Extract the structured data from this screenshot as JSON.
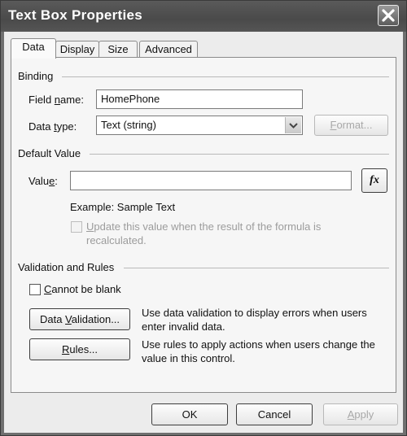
{
  "window": {
    "title": "Text Box Properties"
  },
  "tabs": [
    {
      "label": "Data",
      "active": true
    },
    {
      "label": "Display",
      "active": false
    },
    {
      "label": "Size",
      "active": false
    },
    {
      "label": "Advanced",
      "active": false
    }
  ],
  "binding": {
    "group_label": "Binding",
    "field_name_label_pre": "Field ",
    "field_name_label_u": "n",
    "field_name_label_post": "ame:",
    "field_name_value": "HomePhone",
    "data_type_label_pre": "Data ",
    "data_type_label_u": "t",
    "data_type_label_post": "ype:",
    "data_type_value": "Text (string)",
    "format_button_u": "F",
    "format_button_post": "ormat..."
  },
  "default_value": {
    "group_label": "Default Value",
    "value_label_pre": "Valu",
    "value_label_u": "e",
    "value_label_post": ":",
    "value": "",
    "formula_button": "fx",
    "example": "Example: Sample Text",
    "update_checkbox_u": "U",
    "update_checkbox_post": "pdate this value when the result of the formula is",
    "update_checkbox_line2": "recalculated."
  },
  "validation": {
    "group_label": "Validation and Rules",
    "cannot_be_blank_u": "C",
    "cannot_be_blank_post": "annot be blank",
    "data_validation_button_pre": "Data ",
    "data_validation_button_u": "V",
    "data_validation_button_post": "alidation...",
    "data_validation_help_1": "Use data validation to display errors when users",
    "data_validation_help_2": "enter invalid data.",
    "rules_button_u": "R",
    "rules_button_post": "ules...",
    "rules_help_1": "Use rules to apply actions when users change the",
    "rules_help_2": "value in this control."
  },
  "footer": {
    "ok": "OK",
    "cancel": "Cancel",
    "apply_u": "A",
    "apply_post": "pply"
  }
}
